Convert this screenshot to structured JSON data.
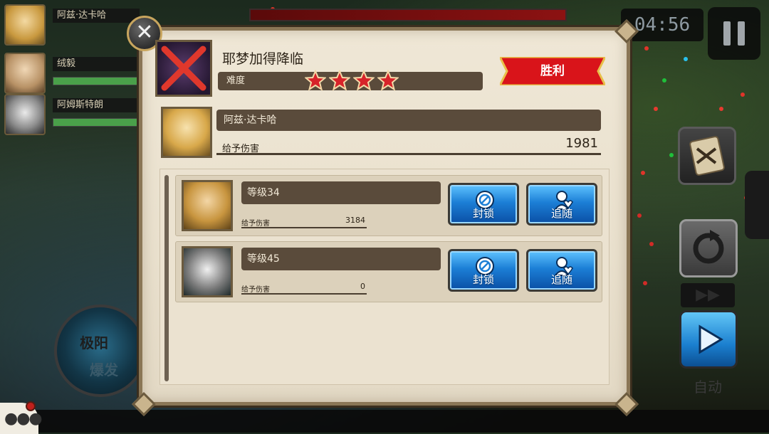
{
  "party": [
    {
      "name": "阿兹·达卡哈",
      "hp": 0.0
    },
    {
      "name": "绒毅",
      "hp": 1.0
    },
    {
      "name": "阿姆斯特朗",
      "hp": 1.0
    }
  ],
  "hud": {
    "timer": "04:56",
    "auto_label": "自动"
  },
  "result": {
    "stage_title": "耶梦加得降临",
    "difficulty_label": "难度",
    "difficulty_stars": 4,
    "outcome": "胜利",
    "leader": {
      "name": "阿兹·达卡哈",
      "damage_label": "给予伤害",
      "damage_value": "1981"
    },
    "friends": [
      {
        "level": "等级34",
        "damage_label": "给予伤害",
        "damage_value": "3184",
        "block_label": "封锁",
        "follow_label": "追随"
      },
      {
        "level": "等级45",
        "damage_label": "给予伤害",
        "damage_value": "0",
        "block_label": "封锁",
        "follow_label": "追随"
      }
    ]
  },
  "skill": {
    "label_top": "极阳",
    "label_bottom": "爆发"
  },
  "colors": {
    "panel_bg": "#efe7d6",
    "victory_red": "#d9141a",
    "star_red": "#d7232a",
    "button_blue": "#1c7fd6"
  }
}
